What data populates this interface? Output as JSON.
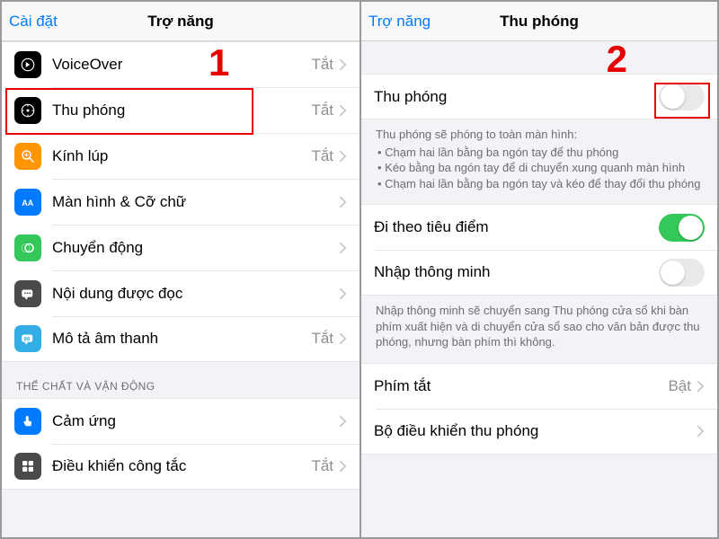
{
  "left": {
    "back": "Cài đặt",
    "title": "Trợ năng",
    "annotation": "1",
    "items": [
      {
        "label": "VoiceOver",
        "value": "Tắt"
      },
      {
        "label": "Thu phóng",
        "value": "Tắt"
      },
      {
        "label": "Kính lúp",
        "value": "Tắt"
      },
      {
        "label": "Màn hình & Cỡ chữ",
        "value": ""
      },
      {
        "label": "Chuyển động",
        "value": ""
      },
      {
        "label": "Nội dung được đọc",
        "value": ""
      },
      {
        "label": "Mô tả âm thanh",
        "value": "Tắt"
      }
    ],
    "section2_header": "THỂ CHẤT VÀ VẬN ĐỘNG",
    "items2": [
      {
        "label": "Cảm ứng",
        "value": ""
      },
      {
        "label": "Điều khiển công tắc",
        "value": "Tắt"
      }
    ]
  },
  "right": {
    "back": "Trợ năng",
    "title": "Thu phóng",
    "annotation": "2",
    "zoom_label": "Thu phóng",
    "zoom_on": false,
    "desc_title": "Thu phóng sẽ phóng to toàn màn hình:",
    "desc_items": [
      "Chạm hai lần bằng ba ngón tay để thu phóng",
      "Kéo bằng ba ngón tay để di chuyển xung quanh màn hình",
      "Chạm hai lần bằng ba ngón tay và kéo để thay đổi thu phóng"
    ],
    "follow_label": "Đi theo tiêu điểm",
    "follow_on": true,
    "smart_label": "Nhập thông minh",
    "smart_on": false,
    "smart_desc": "Nhập thông minh sẽ chuyển sang Thu phóng cửa sổ khi bàn phím xuất hiện và di chuyển cửa sổ sao cho văn bản được thu phóng, nhưng bàn phím thì không.",
    "shortcut_label": "Phím tắt",
    "shortcut_value": "Bật",
    "controller_label": "Bộ điều khiển thu phóng"
  }
}
